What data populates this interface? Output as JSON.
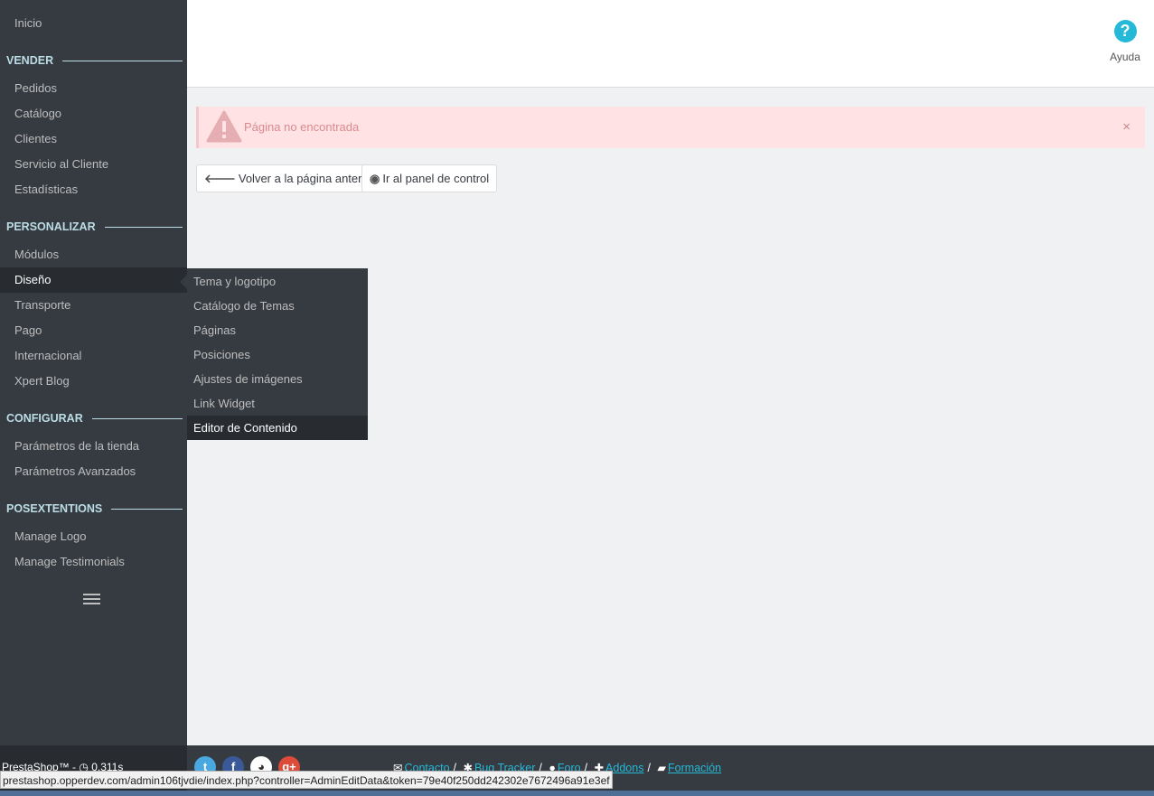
{
  "sidebar": {
    "home": "Inicio",
    "sections": [
      {
        "heading": "VENDER",
        "items": [
          "Pedidos",
          "Catálogo",
          "Clientes",
          "Servicio al Cliente",
          "Estadísticas"
        ]
      },
      {
        "heading": "PERSONALIZAR",
        "items": [
          "Módulos",
          "Diseño",
          "Transporte",
          "Pago",
          "Internacional",
          "Xpert Blog"
        ]
      },
      {
        "heading": "CONFIGURAR",
        "items": [
          "Parámetros de la tienda",
          "Parámetros Avanzados"
        ]
      },
      {
        "heading": "POSEXTENTIONS",
        "items": [
          "Manage Logo",
          "Manage Testimonials"
        ]
      }
    ],
    "active_item": "Diseño",
    "collapse_icon": "hamburger-menu-icon"
  },
  "submenu": {
    "items": [
      "Tema y logotipo",
      "Catálogo de Temas",
      "Páginas",
      "Posiciones",
      "Ajustes de imágenes",
      "Link Widget",
      "Editor de Contenido"
    ],
    "hovered": "Editor de Contenido"
  },
  "header": {
    "help_label": "Ayuda",
    "help_icon": "question-circle-icon"
  },
  "alert": {
    "message": "Página no encontrada",
    "close": "×",
    "icon": "warning-triangle-icon"
  },
  "actions": {
    "back_label": "Volver a la página anterior",
    "dashboard_label": "Ir al panel de control"
  },
  "footer": {
    "brand": "PrestaShop™ - ",
    "load_time": "0.311s",
    "links": [
      "Contacto",
      "Bug Tracker",
      "Foro",
      "Addons",
      "Formación"
    ],
    "social": [
      "twitter-icon",
      "facebook-icon",
      "github-icon",
      "google-plus-icon"
    ]
  },
  "status_url": "prestashop.opperdev.com/admin106tjvdie/index.php?controller=AdminEditData&token=79e40f250dd242302e7672496a91e3ef",
  "colors": {
    "sidebar_bg": "#363a41",
    "active_bg": "#282b30",
    "heading_color": "#bcdde6",
    "accent": "#25b9d7",
    "alert_bg": "#ffe2e4"
  }
}
